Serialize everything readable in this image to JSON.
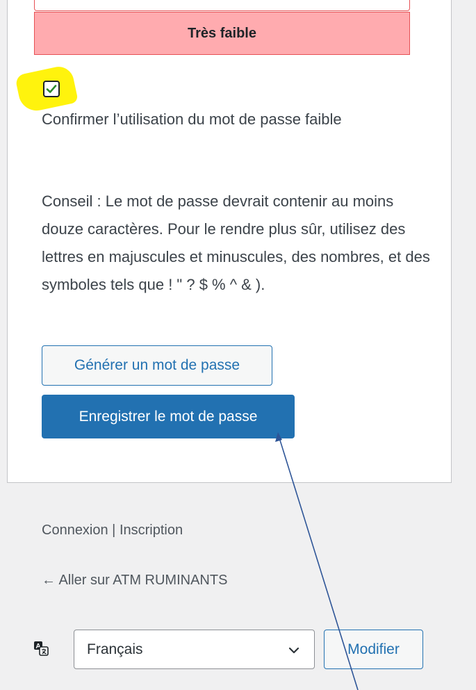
{
  "password": {
    "strength_label": "Très faible"
  },
  "confirm_weak": {
    "checked": true,
    "label": "Confirmer l’utilisation du mot de passe faible"
  },
  "hint": {
    "text": "Conseil : Le mot de passe devrait contenir au moins douze caractères. Pour le rendre plus sûr, utilisez des lettres en majuscules et minuscules, des nombres, et des symboles tels que ! \" ? $ % ^ & )."
  },
  "buttons": {
    "generate_label": "Générer un mot de passe",
    "save_label": "Enregistrer le mot de passe",
    "modify_label": "Modifier"
  },
  "footer_nav": {
    "login_label": "Connexion",
    "separator": " | ",
    "register_label": "Inscription",
    "back_label": "← Aller sur ATM RUMINANTS"
  },
  "language": {
    "selected": "Français",
    "icon": "translation-icon"
  },
  "colors": {
    "primary": "#2271b1",
    "strength_bg": "#ffabaf",
    "strength_border": "#e65054",
    "highlight": "#fff200",
    "page_bg": "#f0f0f1"
  }
}
